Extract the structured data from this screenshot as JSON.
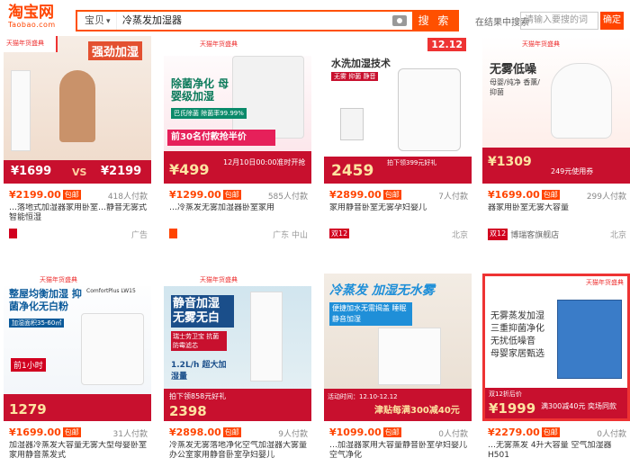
{
  "header": {
    "logo": "淘宝网",
    "logo_sub": "Taobao.com",
    "search_category": "宝贝",
    "search_query": "冷蒸发加湿器",
    "search_button": "搜 索",
    "result_search_label": "在结果中搜索",
    "result_search_placeholder": "请输入要搜的词",
    "result_confirm": "确定"
  },
  "colors": {
    "accent": "#ff5000",
    "price": "#ff4400"
  },
  "products": [
    {
      "price": "¥2199.00",
      "baoyou": "包邮",
      "deals": "418人付款",
      "title": "…静音无雾式智能恒湿",
      "title_pre": "…落地式加湿器家用卧室",
      "banner": "强劲加湿",
      "img_price1": "¥1699",
      "img_price2": "¥2199",
      "vs": "VS",
      "tag1": "",
      "loc": "",
      "extra": "广告",
      "festival": "天猫年货盛典"
    },
    {
      "price": "¥1299.00",
      "baoyou": "包邮",
      "deals": "585人付款",
      "title": "…冷蒸发无雾加湿器卧室家用",
      "title_pre": "",
      "banner": "除菌净化 母婴级加湿",
      "img_price1": "¥499",
      "img_price2": "",
      "vs": "",
      "tag1": "",
      "loc": "广东 中山",
      "extra": "",
      "promo": "前30名付款抢半价",
      "festival": "天猫年货盛典",
      "sub": "巴氏除菌 除菌率99.99%",
      "date": "12月10日00:00准时开抢"
    },
    {
      "price": "¥2899.00",
      "baoyou": "包邮",
      "deals": "7人付款",
      "title": "家用静音卧室无雾孕妇婴儿",
      "title_pre": "",
      "banner": "水洗加湿技术",
      "img_price1": "2459",
      "img_price2": "",
      "vs": "",
      "tag1": "双12",
      "loc": "北京",
      "extra": "",
      "festival": "12.12",
      "sub": "无雾 抑菌 静音",
      "promo": "拍下领399元好礼"
    },
    {
      "price": "¥1699.00",
      "baoyou": "包邮",
      "deals": "299人付款",
      "title": "器家用卧室无雾大容量",
      "title_pre": "",
      "banner": "无雾低噪",
      "img_price1": "¥1309",
      "img_price2": "",
      "vs": "",
      "tag1": "双12",
      "loc": "北京",
      "extra": "广告",
      "shop": "博瑞客旗舰店",
      "festival": "天猫年货盛典",
      "sub": "母婴/纯净 香薰/抑菌",
      "promo": "249元使用券"
    },
    {
      "price": "¥1699.00",
      "baoyou": "包邮",
      "deals": "31人付款",
      "title": "加湿器冷蒸发大容量无雾大型母婴卧室家用静音蒸发式",
      "title_pre": "",
      "banner": "整屋均衡加湿 抑菌净化无白粉",
      "img_price1": "1279",
      "img_price2": "",
      "vs": "",
      "tag1": "",
      "loc": "",
      "extra": "",
      "festival": "天猫年货盛典",
      "sub": "加湿面积35-60㎡",
      "promo": "前1小时",
      "model": "ComfortPlus LW15"
    },
    {
      "price": "¥2898.00",
      "baoyou": "包邮",
      "deals": "9人付款",
      "title": "冷蒸发无雾落地净化空气加湿器大雾量办公室家用静音卧室孕妇婴儿",
      "title_pre": "",
      "banner": "静音加湿 无雾无白",
      "img_price1": "2398",
      "img_price2": "",
      "vs": "",
      "tag1": "",
      "loc": "",
      "extra": "",
      "festival": "天猫年货盛典",
      "sub": "瑞士劳卫宝 抗菌防霉滤芯",
      "spec": "1.2L/h 超大加湿量",
      "promo": "拍下领858元好礼"
    },
    {
      "price": "¥1099.00",
      "baoyou": "包邮",
      "deals": "0人付款",
      "title": "…加湿器家用大容量静音卧室孕妇婴儿空气净化",
      "title_pre": "",
      "banner": "冷蒸发 加湿无水雾",
      "img_price1": "",
      "img_price2": "",
      "vs": "",
      "tag1": "",
      "loc": "",
      "extra": "",
      "festival": "",
      "sub": "便捷加水无需揭盖 睡眠静音加湿",
      "promo": "津贴每满300减40元",
      "date": "活动时间：12.10-12.12"
    },
    {
      "price": "¥2279.00",
      "baoyou": "包邮",
      "deals": "0人付款",
      "title": "…无雾蒸发 4升大容量 空气加湿器 H501",
      "title_pre": "",
      "banner": "无雾蒸发加湿 三重抑菌净化 无扰低噪音 母婴家居甄选",
      "img_price1": "¥1999",
      "img_price2": "",
      "vs": "",
      "tag1": "",
      "loc": "",
      "extra": "",
      "festival": "天猫年货盛典",
      "promo": "满300减40元 奕场同款",
      "sub": "双12折后价"
    }
  ]
}
